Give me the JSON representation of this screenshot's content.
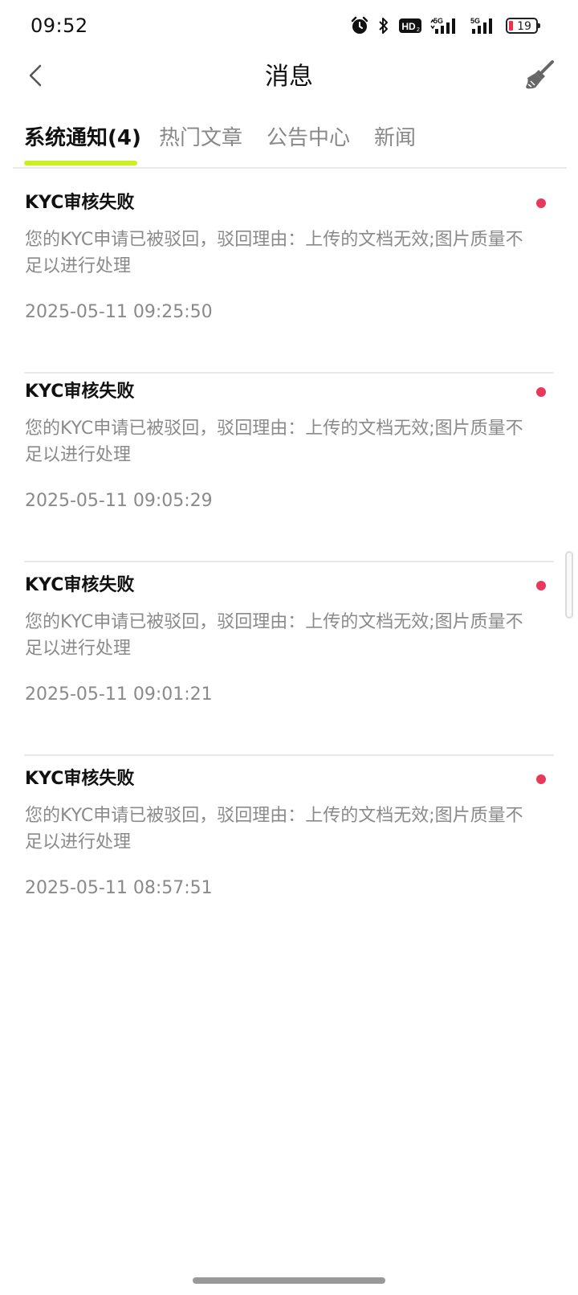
{
  "status_bar": {
    "time": "09:52",
    "battery_level": "19",
    "hd_label": "HD",
    "network_label_1": "5G",
    "network_label_2": "5G",
    "icons": [
      "alarm-icon",
      "bluetooth-icon",
      "hd-icon",
      "signal-icon",
      "signal-icon",
      "battery-icon"
    ]
  },
  "header": {
    "title": "消息",
    "back_icon": "chevron-left-icon",
    "clean_icon": "broom-icon"
  },
  "tabs": [
    {
      "label": "系统通知(4)",
      "active": true
    },
    {
      "label": "热门文章",
      "active": false
    },
    {
      "label": "公告中心",
      "active": false
    },
    {
      "label": "新闻",
      "active": false
    }
  ],
  "colors": {
    "accent": "#c9f21c",
    "unread_dot": "#e8395a",
    "secondary_text": "#8a8a8a"
  },
  "messages": [
    {
      "title": "KYC审核失败",
      "body": "您的KYC申请已被驳回，驳回理由：上传的文档无效;图片质量不足以进行处理",
      "time": "2025-05-11 09:25:50",
      "unread": true
    },
    {
      "title": "KYC审核失败",
      "body": "您的KYC申请已被驳回，驳回理由：上传的文档无效;图片质量不足以进行处理",
      "time": "2025-05-11 09:05:29",
      "unread": true
    },
    {
      "title": "KYC审核失败",
      "body": "您的KYC申请已被驳回，驳回理由：上传的文档无效;图片质量不足以进行处理",
      "time": "2025-05-11 09:01:21",
      "unread": true
    },
    {
      "title": "KYC审核失败",
      "body": "您的KYC申请已被驳回，驳回理由：上传的文档无效;图片质量不足以进行处理",
      "time": "2025-05-11 08:57:51",
      "unread": true
    }
  ]
}
